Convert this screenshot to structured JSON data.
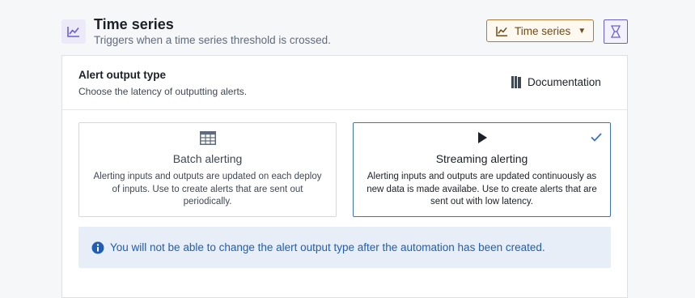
{
  "header": {
    "title": "Time series",
    "subtitle": "Triggers when a time series threshold is crossed.",
    "icon": "line-chart-icon",
    "type_button_label": "Time series",
    "type_button_icon": "line-chart-icon",
    "hex_button_icon": "hexagon-icon"
  },
  "section": {
    "title": "Alert output type",
    "subtitle": "Choose the latency of outputting alerts.",
    "documentation_label": "Documentation",
    "documentation_icon": "book-icon"
  },
  "options": [
    {
      "title": "Batch alerting",
      "description": "Alerting inputs and outputs are updated on each deploy of inputs. Use to create alerts that are sent out periodically.",
      "icon": "table-icon",
      "selected": false
    },
    {
      "title": "Streaming alerting",
      "description": "Alerting inputs and outputs are updated continuously as new data is made availabe. Use to create alerts that are sent out with low latency.",
      "icon": "play-icon",
      "selected": true
    }
  ],
  "callout": {
    "message": "You will not be able to change the alert output type after the automation has been created.",
    "icon": "info-icon"
  },
  "colors": {
    "accent_purple": "#6a5fd1",
    "accent_gold": "#b07b34",
    "selected_blue": "#3d73b8",
    "callout_text": "#215db0",
    "callout_bg": "#e7eef8"
  }
}
